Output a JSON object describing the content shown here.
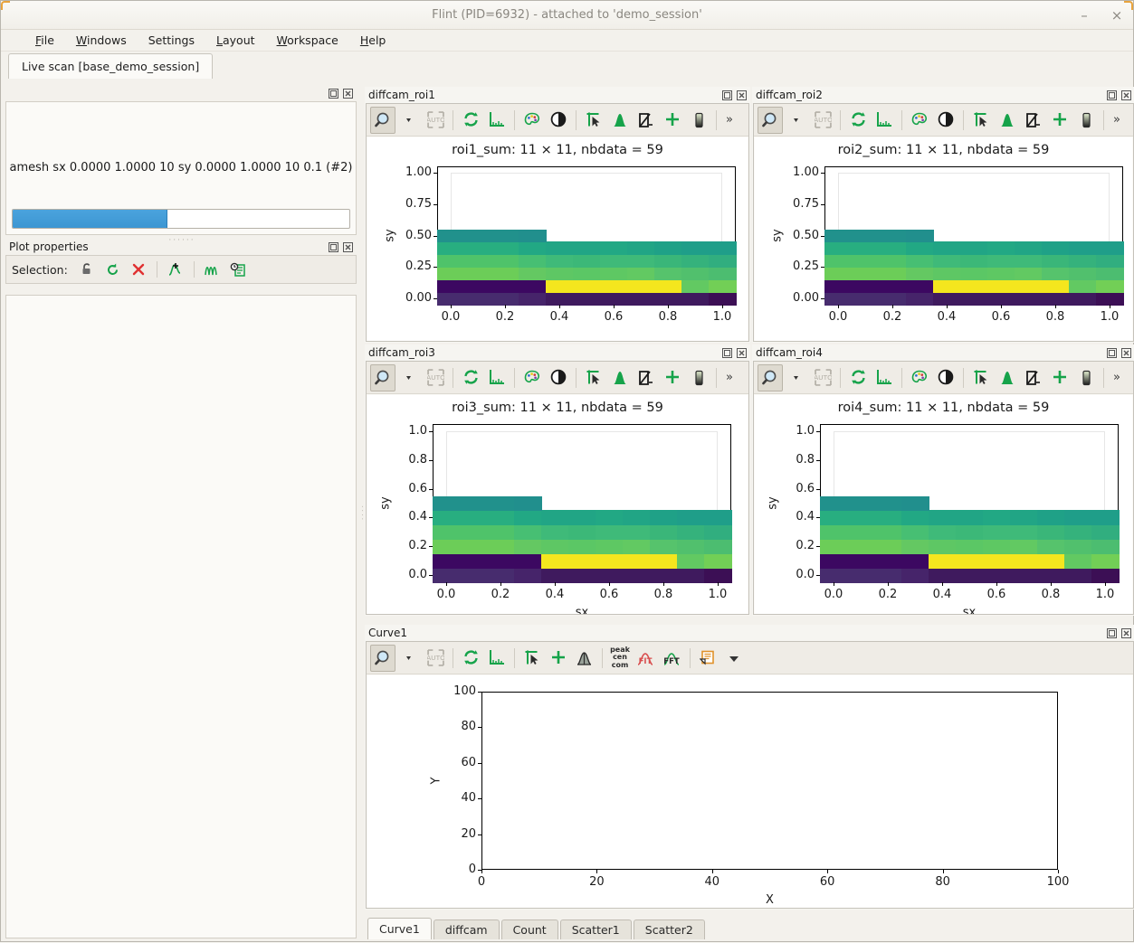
{
  "window": {
    "title": "Flint (PID=6932) - attached to 'demo_session'",
    "minimize_label": "–",
    "close_label": "×"
  },
  "menubar": {
    "items": [
      {
        "label": "File",
        "mnemonic": "F"
      },
      {
        "label": "Windows",
        "mnemonic": "W"
      },
      {
        "label": "Settings",
        "mnemonic": "S"
      },
      {
        "label": "Layout",
        "mnemonic": "L"
      },
      {
        "label": "Workspace",
        "mnemonic": "W"
      },
      {
        "label": "Help",
        "mnemonic": "H"
      }
    ]
  },
  "main_tab": {
    "label": "Live scan [base_demo_session]"
  },
  "scan_panel": {
    "command": "amesh sx 0.0000 1.0000 10 sy 0.0000 1.0000 10 0.1 (#2)",
    "progress_percent": 46,
    "progress_color": "#4aa3dd"
  },
  "plot_properties": {
    "title": "Plot properties",
    "selection_label": "Selection:",
    "tools": [
      {
        "name": "lock-icon",
        "tooltip": "Lock selection"
      },
      {
        "name": "reset-icon",
        "tooltip": "Reset"
      },
      {
        "name": "delete-icon",
        "tooltip": "Remove"
      },
      {
        "name": "add-marker-icon",
        "tooltip": "Add marker"
      },
      {
        "name": "curves-icon",
        "tooltip": "Curves"
      },
      {
        "name": "log-icon",
        "tooltip": "History"
      }
    ]
  },
  "image_toolbar": {
    "buttons": [
      {
        "name": "zoom-icon",
        "tooltip": "Zoom",
        "pressed": true
      },
      {
        "name": "zoom-dropdown-icon",
        "tooltip": "Zoom mode"
      },
      {
        "name": "auto-scale-icon",
        "tooltip": "Auto scale",
        "disabled": true
      },
      {
        "name": "refresh-icon",
        "tooltip": "Reset zoom"
      },
      {
        "name": "axes-icon",
        "tooltip": "Axes"
      },
      {
        "name": "colormap-icon",
        "tooltip": "Colormap"
      },
      {
        "name": "contrast-icon",
        "tooltip": "Contrast"
      },
      {
        "name": "cursor-icon",
        "tooltip": "Pointer"
      },
      {
        "name": "peak-icon",
        "tooltip": "Peak"
      },
      {
        "name": "roi-icon",
        "tooltip": "ROI"
      },
      {
        "name": "crosshair-icon",
        "tooltip": "Marker"
      },
      {
        "name": "colorbar-icon",
        "tooltip": "Colorbar"
      },
      {
        "name": "overflow-icon",
        "tooltip": "More",
        "label": "»"
      }
    ]
  },
  "curve_toolbar": {
    "buttons": [
      {
        "name": "zoom-icon",
        "tooltip": "Zoom",
        "pressed": true
      },
      {
        "name": "zoom-dropdown-icon",
        "tooltip": "Zoom mode"
      },
      {
        "name": "auto-scale-icon",
        "tooltip": "Auto scale",
        "disabled": true
      },
      {
        "name": "refresh-icon",
        "tooltip": "Reset zoom"
      },
      {
        "name": "axes-icon",
        "tooltip": "Axes"
      },
      {
        "name": "cursor-icon",
        "tooltip": "Pointer"
      },
      {
        "name": "crosshair-icon",
        "tooltip": "Marker"
      },
      {
        "name": "gaussian-icon",
        "tooltip": "Statistics"
      },
      {
        "name": "peak-cen-com-icon",
        "tooltip": "peak cen com",
        "label": "peak\ncen\ncom"
      },
      {
        "name": "fit-icon",
        "tooltip": "Fit",
        "label": "FIT"
      },
      {
        "name": "fft-icon",
        "tooltip": "FFT",
        "label": "FFT"
      },
      {
        "name": "export-icon",
        "tooltip": "Export"
      },
      {
        "name": "export-dropdown-icon",
        "tooltip": "Export options"
      }
    ]
  },
  "panels": [
    {
      "id": "roi1",
      "title": "diffcam_roi1",
      "chart_index": 0
    },
    {
      "id": "roi2",
      "title": "diffcam_roi2",
      "chart_index": 1
    },
    {
      "id": "roi3",
      "title": "diffcam_roi3",
      "chart_index": 2
    },
    {
      "id": "roi4",
      "title": "diffcam_roi4",
      "chart_index": 3
    },
    {
      "id": "curve1",
      "title": "Curve1",
      "chart_index": 4
    }
  ],
  "bottom_tabs": {
    "items": [
      {
        "label": "Curve1",
        "active": true
      },
      {
        "label": "diffcam",
        "active": false
      },
      {
        "label": "Count",
        "active": false
      },
      {
        "label": "Scatter1",
        "active": false
      },
      {
        "label": "Scatter2",
        "active": false
      }
    ]
  },
  "dock_buttons": {
    "float": "❐",
    "close": "☒"
  },
  "chart_data": [
    {
      "type": "heatmap",
      "title": "roi1_sum: 11 × 11, nbdata = 59",
      "xlabel": "",
      "ylabel": "sy",
      "xticks": [
        "0.0",
        "0.2",
        "0.4",
        "0.6",
        "0.8",
        "1.0"
      ],
      "xtick_values": [
        0.0,
        0.2,
        0.4,
        0.6,
        0.8,
        1.0
      ],
      "yticks": [
        "0.00",
        "0.25",
        "0.50",
        "0.75",
        "1.00"
      ],
      "ytick_values": [
        0.0,
        0.25,
        0.5,
        0.75,
        1.0
      ],
      "xlim": [
        -0.05,
        1.05
      ],
      "ylim": [
        -0.05,
        1.05
      ],
      "grid": false,
      "colormap": "viridis",
      "nrows": 11,
      "ncols": 11,
      "nbdata": 59,
      "cell_colors": [
        [
          "#472c6e",
          "#472c6e",
          "#472c6e",
          "#46246a",
          "#3f1a5e",
          "#3f1a5e",
          "#3f1a5e",
          "#3f1a5e",
          "#3f1a5e",
          "#3f1a5e",
          "#3c0f55"
        ],
        [
          "#3c0861",
          "#3c0861",
          "#3c0861",
          "#3c0861",
          "#f4e61e",
          "#f4e61e",
          "#f4e61e",
          "#f4e61e",
          "#f4e61e",
          "#62c962",
          "#72cf56"
        ],
        [
          "#6ccd58",
          "#6ccd58",
          "#6ccd58",
          "#64c862",
          "#5ec764",
          "#5bc765",
          "#5ec863",
          "#62c962",
          "#56c36c",
          "#51c06d",
          "#4cbd70"
        ],
        [
          "#4fc36a",
          "#4fc36a",
          "#4fc36a",
          "#47bf73",
          "#3fba79",
          "#3cb878",
          "#3fba79",
          "#3fba79",
          "#3ab679",
          "#35b27c",
          "#31ae7f"
        ],
        [
          "#28ae80",
          "#28ae80",
          "#28ae80",
          "#22a884",
          "#21a585",
          "#21a585",
          "#22a884",
          "#21a585",
          "#1fa187",
          "#1f9e89",
          "#1f9e89"
        ],
        [
          "#21918c",
          "#21918c",
          "#21918c",
          "#218f8d",
          null,
          null,
          null,
          null,
          null,
          null,
          null
        ],
        [
          null,
          null,
          null,
          null,
          null,
          null,
          null,
          null,
          null,
          null,
          null
        ],
        [
          null,
          null,
          null,
          null,
          null,
          null,
          null,
          null,
          null,
          null,
          null
        ],
        [
          null,
          null,
          null,
          null,
          null,
          null,
          null,
          null,
          null,
          null,
          null
        ],
        [
          null,
          null,
          null,
          null,
          null,
          null,
          null,
          null,
          null,
          null,
          null
        ],
        [
          null,
          null,
          null,
          null,
          null,
          null,
          null,
          null,
          null,
          null,
          null
        ]
      ]
    },
    {
      "type": "heatmap",
      "title": "roi2_sum: 11 × 11, nbdata = 59",
      "xlabel": "",
      "ylabel": "sy",
      "xticks": [
        "0.0",
        "0.2",
        "0.4",
        "0.6",
        "0.8",
        "1.0"
      ],
      "xtick_values": [
        0.0,
        0.2,
        0.4,
        0.6,
        0.8,
        1.0
      ],
      "yticks": [
        "0.00",
        "0.25",
        "0.50",
        "0.75",
        "1.00"
      ],
      "ytick_values": [
        0.0,
        0.25,
        0.5,
        0.75,
        1.0
      ],
      "xlim": [
        -0.05,
        1.05
      ],
      "ylim": [
        -0.05,
        1.05
      ],
      "grid": false,
      "colormap": "viridis",
      "nrows": 11,
      "ncols": 11,
      "nbdata": 59,
      "cell_colors": [
        [
          "#472c6e",
          "#472c6e",
          "#472c6e",
          "#46246a",
          "#3f1a5e",
          "#3f1a5e",
          "#3f1a5e",
          "#3f1a5e",
          "#3f1a5e",
          "#3f1a5e",
          "#3c0f55"
        ],
        [
          "#3c0861",
          "#3c0861",
          "#3c0861",
          "#3c0861",
          "#f4e61e",
          "#f4e61e",
          "#f4e61e",
          "#f4e61e",
          "#f4e61e",
          "#62c962",
          "#72cf56"
        ],
        [
          "#6ccd58",
          "#6ccd58",
          "#6ccd58",
          "#64c862",
          "#5ec764",
          "#5bc765",
          "#5ec863",
          "#62c962",
          "#56c36c",
          "#51c06d",
          "#4cbd70"
        ],
        [
          "#4fc36a",
          "#4fc36a",
          "#4fc36a",
          "#47bf73",
          "#3fba79",
          "#3cb878",
          "#3fba79",
          "#3fba79",
          "#3ab679",
          "#35b27c",
          "#31ae7f"
        ],
        [
          "#28ae80",
          "#28ae80",
          "#28ae80",
          "#22a884",
          "#21a585",
          "#21a585",
          "#22a884",
          "#21a585",
          "#1fa187",
          "#1f9e89",
          "#1f9e89"
        ],
        [
          "#21918c",
          "#21918c",
          "#21918c",
          "#218f8d",
          null,
          null,
          null,
          null,
          null,
          null,
          null
        ],
        [
          null,
          null,
          null,
          null,
          null,
          null,
          null,
          null,
          null,
          null,
          null
        ],
        [
          null,
          null,
          null,
          null,
          null,
          null,
          null,
          null,
          null,
          null,
          null
        ],
        [
          null,
          null,
          null,
          null,
          null,
          null,
          null,
          null,
          null,
          null,
          null
        ],
        [
          null,
          null,
          null,
          null,
          null,
          null,
          null,
          null,
          null,
          null,
          null
        ],
        [
          null,
          null,
          null,
          null,
          null,
          null,
          null,
          null,
          null,
          null,
          null
        ]
      ]
    },
    {
      "type": "heatmap",
      "title": "roi3_sum: 11 × 11, nbdata = 59",
      "xlabel": "sx",
      "ylabel": "sy",
      "xticks": [
        "0.0",
        "0.2",
        "0.4",
        "0.6",
        "0.8",
        "1.0"
      ],
      "xtick_values": [
        0.0,
        0.2,
        0.4,
        0.6,
        0.8,
        1.0
      ],
      "yticks": [
        "0.0",
        "0.2",
        "0.4",
        "0.6",
        "0.8",
        "1.0"
      ],
      "ytick_values": [
        0.0,
        0.2,
        0.4,
        0.6,
        0.8,
        1.0
      ],
      "xlim": [
        -0.05,
        1.05
      ],
      "ylim": [
        -0.05,
        1.05
      ],
      "grid": false,
      "colormap": "viridis",
      "nrows": 11,
      "ncols": 11,
      "nbdata": 59,
      "cell_colors": [
        [
          "#472c6e",
          "#472c6e",
          "#472c6e",
          "#46246a",
          "#3f1a5e",
          "#3f1a5e",
          "#3f1a5e",
          "#3f1a5e",
          "#3f1a5e",
          "#3f1a5e",
          "#3c0f55"
        ],
        [
          "#3c0861",
          "#3c0861",
          "#3c0861",
          "#3c0861",
          "#f4e61e",
          "#f4e61e",
          "#f4e61e",
          "#f4e61e",
          "#f4e61e",
          "#62c962",
          "#72cf56"
        ],
        [
          "#6ccd58",
          "#6ccd58",
          "#6ccd58",
          "#64c862",
          "#5ec764",
          "#5bc765",
          "#5ec863",
          "#62c962",
          "#56c36c",
          "#51c06d",
          "#4cbd70"
        ],
        [
          "#4fc36a",
          "#4fc36a",
          "#4fc36a",
          "#47bf73",
          "#3fba79",
          "#3cb878",
          "#3fba79",
          "#3fba79",
          "#3ab679",
          "#35b27c",
          "#31ae7f"
        ],
        [
          "#28ae80",
          "#28ae80",
          "#28ae80",
          "#22a884",
          "#21a585",
          "#21a585",
          "#22a884",
          "#21a585",
          "#1fa187",
          "#1f9e89",
          "#1f9e89"
        ],
        [
          "#21918c",
          "#21918c",
          "#21918c",
          "#218f8d",
          null,
          null,
          null,
          null,
          null,
          null,
          null
        ],
        [
          null,
          null,
          null,
          null,
          null,
          null,
          null,
          null,
          null,
          null,
          null
        ],
        [
          null,
          null,
          null,
          null,
          null,
          null,
          null,
          null,
          null,
          null,
          null
        ],
        [
          null,
          null,
          null,
          null,
          null,
          null,
          null,
          null,
          null,
          null,
          null
        ],
        [
          null,
          null,
          null,
          null,
          null,
          null,
          null,
          null,
          null,
          null,
          null
        ],
        [
          null,
          null,
          null,
          null,
          null,
          null,
          null,
          null,
          null,
          null,
          null
        ]
      ]
    },
    {
      "type": "heatmap",
      "title": "roi4_sum: 11 × 11, nbdata = 59",
      "xlabel": "sx",
      "ylabel": "sy",
      "xticks": [
        "0.0",
        "0.2",
        "0.4",
        "0.6",
        "0.8",
        "1.0"
      ],
      "xtick_values": [
        0.0,
        0.2,
        0.4,
        0.6,
        0.8,
        1.0
      ],
      "yticks": [
        "0.0",
        "0.2",
        "0.4",
        "0.6",
        "0.8",
        "1.0"
      ],
      "ytick_values": [
        0.0,
        0.2,
        0.4,
        0.6,
        0.8,
        1.0
      ],
      "xlim": [
        -0.05,
        1.05
      ],
      "ylim": [
        -0.05,
        1.05
      ],
      "grid": false,
      "colormap": "viridis",
      "nrows": 11,
      "ncols": 11,
      "nbdata": 59,
      "cell_colors": [
        [
          "#472c6e",
          "#472c6e",
          "#472c6e",
          "#46246a",
          "#3f1a5e",
          "#3f1a5e",
          "#3f1a5e",
          "#3f1a5e",
          "#3f1a5e",
          "#3f1a5e",
          "#3c0f55"
        ],
        [
          "#3c0861",
          "#3c0861",
          "#3c0861",
          "#3c0861",
          "#f4e61e",
          "#f4e61e",
          "#f4e61e",
          "#f4e61e",
          "#f4e61e",
          "#62c962",
          "#72cf56"
        ],
        [
          "#6ccd58",
          "#6ccd58",
          "#6ccd58",
          "#64c862",
          "#5ec764",
          "#5bc765",
          "#5ec863",
          "#62c962",
          "#56c36c",
          "#51c06d",
          "#4cbd70"
        ],
        [
          "#4fc36a",
          "#4fc36a",
          "#4fc36a",
          "#47bf73",
          "#3fba79",
          "#3cb878",
          "#3fba79",
          "#3fba79",
          "#3ab679",
          "#35b27c",
          "#31ae7f"
        ],
        [
          "#28ae80",
          "#28ae80",
          "#28ae80",
          "#22a884",
          "#21a585",
          "#21a585",
          "#22a884",
          "#21a585",
          "#1fa187",
          "#1f9e89",
          "#1f9e89"
        ],
        [
          "#21918c",
          "#21918c",
          "#21918c",
          "#218f8d",
          null,
          null,
          null,
          null,
          null,
          null,
          null
        ],
        [
          null,
          null,
          null,
          null,
          null,
          null,
          null,
          null,
          null,
          null,
          null
        ],
        [
          null,
          null,
          null,
          null,
          null,
          null,
          null,
          null,
          null,
          null,
          null
        ],
        [
          null,
          null,
          null,
          null,
          null,
          null,
          null,
          null,
          null,
          null,
          null
        ],
        [
          null,
          null,
          null,
          null,
          null,
          null,
          null,
          null,
          null,
          null,
          null
        ],
        [
          null,
          null,
          null,
          null,
          null,
          null,
          null,
          null,
          null,
          null,
          null
        ]
      ]
    },
    {
      "type": "line",
      "title": "",
      "xlabel": "X",
      "ylabel": "Y",
      "xticks": [
        "0",
        "20",
        "40",
        "60",
        "80",
        "100"
      ],
      "xtick_values": [
        0,
        20,
        40,
        60,
        80,
        100
      ],
      "yticks": [
        "0",
        "20",
        "40",
        "60",
        "80",
        "100"
      ],
      "ytick_values": [
        0,
        20,
        40,
        60,
        80,
        100
      ],
      "xlim": [
        0,
        100
      ],
      "ylim": [
        0,
        100
      ],
      "grid": false,
      "series": []
    }
  ]
}
